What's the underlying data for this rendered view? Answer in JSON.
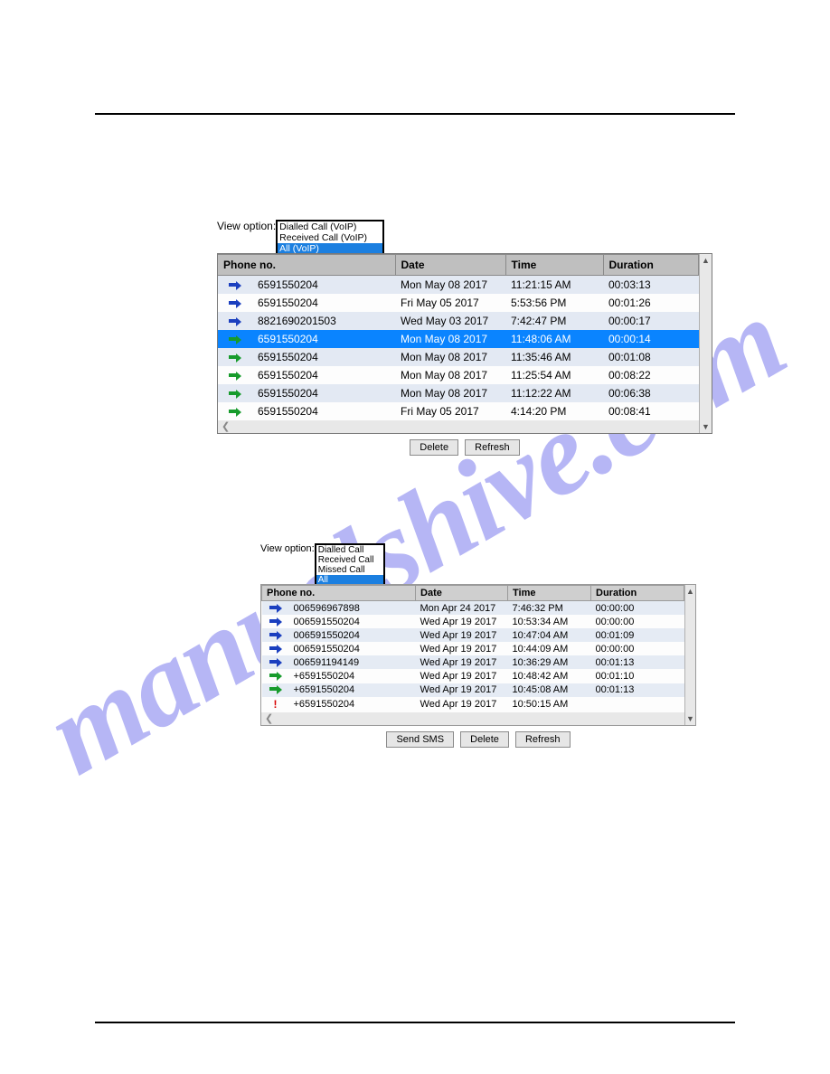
{
  "watermark": "manualshive.com",
  "panel1": {
    "view_label": "View option:",
    "options": [
      "Dialled Call (VoIP)",
      "Received Call (VoIP)",
      "All (VoIP)"
    ],
    "selected_option": 2,
    "headers": {
      "phone": "Phone no.",
      "date": "Date",
      "time": "Time",
      "duration": "Duration"
    },
    "rows": [
      {
        "icon": "out",
        "phone": "6591550204",
        "date": "Mon May 08 2017",
        "time": "11:21:15 AM",
        "dur": "00:03:13",
        "hl": false
      },
      {
        "icon": "out",
        "phone": "6591550204",
        "date": "Fri May 05 2017",
        "time": "5:53:56 PM",
        "dur": "00:01:26",
        "hl": false
      },
      {
        "icon": "out",
        "phone": "8821690201503",
        "date": "Wed May 03 2017",
        "time": "7:42:47 PM",
        "dur": "00:00:17",
        "hl": false
      },
      {
        "icon": "in",
        "phone": "6591550204",
        "date": "Mon May 08 2017",
        "time": "11:48:06 AM",
        "dur": "00:00:14",
        "hl": true
      },
      {
        "icon": "in",
        "phone": "6591550204",
        "date": "Mon May 08 2017",
        "time": "11:35:46 AM",
        "dur": "00:01:08",
        "hl": false
      },
      {
        "icon": "in",
        "phone": "6591550204",
        "date": "Mon May 08 2017",
        "time": "11:25:54 AM",
        "dur": "00:08:22",
        "hl": false
      },
      {
        "icon": "in",
        "phone": "6591550204",
        "date": "Mon May 08 2017",
        "time": "11:12:22 AM",
        "dur": "00:06:38",
        "hl": false
      },
      {
        "icon": "in",
        "phone": "6591550204",
        "date": "Fri May 05 2017",
        "time": "4:14:20 PM",
        "dur": "00:08:41",
        "hl": false
      }
    ],
    "buttons": {
      "delete": "Delete",
      "refresh": "Refresh"
    }
  },
  "panel2": {
    "view_label": "View option:",
    "options": [
      "Dialled Call",
      "Received Call",
      "Missed Call",
      "All"
    ],
    "selected_option": 3,
    "headers": {
      "phone": "Phone no.",
      "date": "Date",
      "time": "Time",
      "duration": "Duration"
    },
    "rows": [
      {
        "icon": "out",
        "phone": "006596967898",
        "date": "Mon Apr 24 2017",
        "time": "7:46:32 PM",
        "dur": "00:00:00"
      },
      {
        "icon": "out",
        "phone": "006591550204",
        "date": "Wed Apr 19 2017",
        "time": "10:53:34 AM",
        "dur": "00:00:00"
      },
      {
        "icon": "out",
        "phone": "006591550204",
        "date": "Wed Apr 19 2017",
        "time": "10:47:04 AM",
        "dur": "00:01:09"
      },
      {
        "icon": "out",
        "phone": "006591550204",
        "date": "Wed Apr 19 2017",
        "time": "10:44:09 AM",
        "dur": "00:00:00"
      },
      {
        "icon": "out",
        "phone": "006591194149",
        "date": "Wed Apr 19 2017",
        "time": "10:36:29 AM",
        "dur": "00:01:13"
      },
      {
        "icon": "in",
        "phone": "+6591550204",
        "date": "Wed Apr 19 2017",
        "time": "10:48:42 AM",
        "dur": "00:01:10"
      },
      {
        "icon": "in",
        "phone": "+6591550204",
        "date": "Wed Apr 19 2017",
        "time": "10:45:08 AM",
        "dur": "00:01:13"
      },
      {
        "icon": "miss",
        "phone": "+6591550204",
        "date": "Wed Apr 19 2017",
        "time": "10:50:15 AM",
        "dur": ""
      }
    ],
    "buttons": {
      "send_sms": "Send SMS",
      "delete": "Delete",
      "refresh": "Refresh"
    }
  }
}
